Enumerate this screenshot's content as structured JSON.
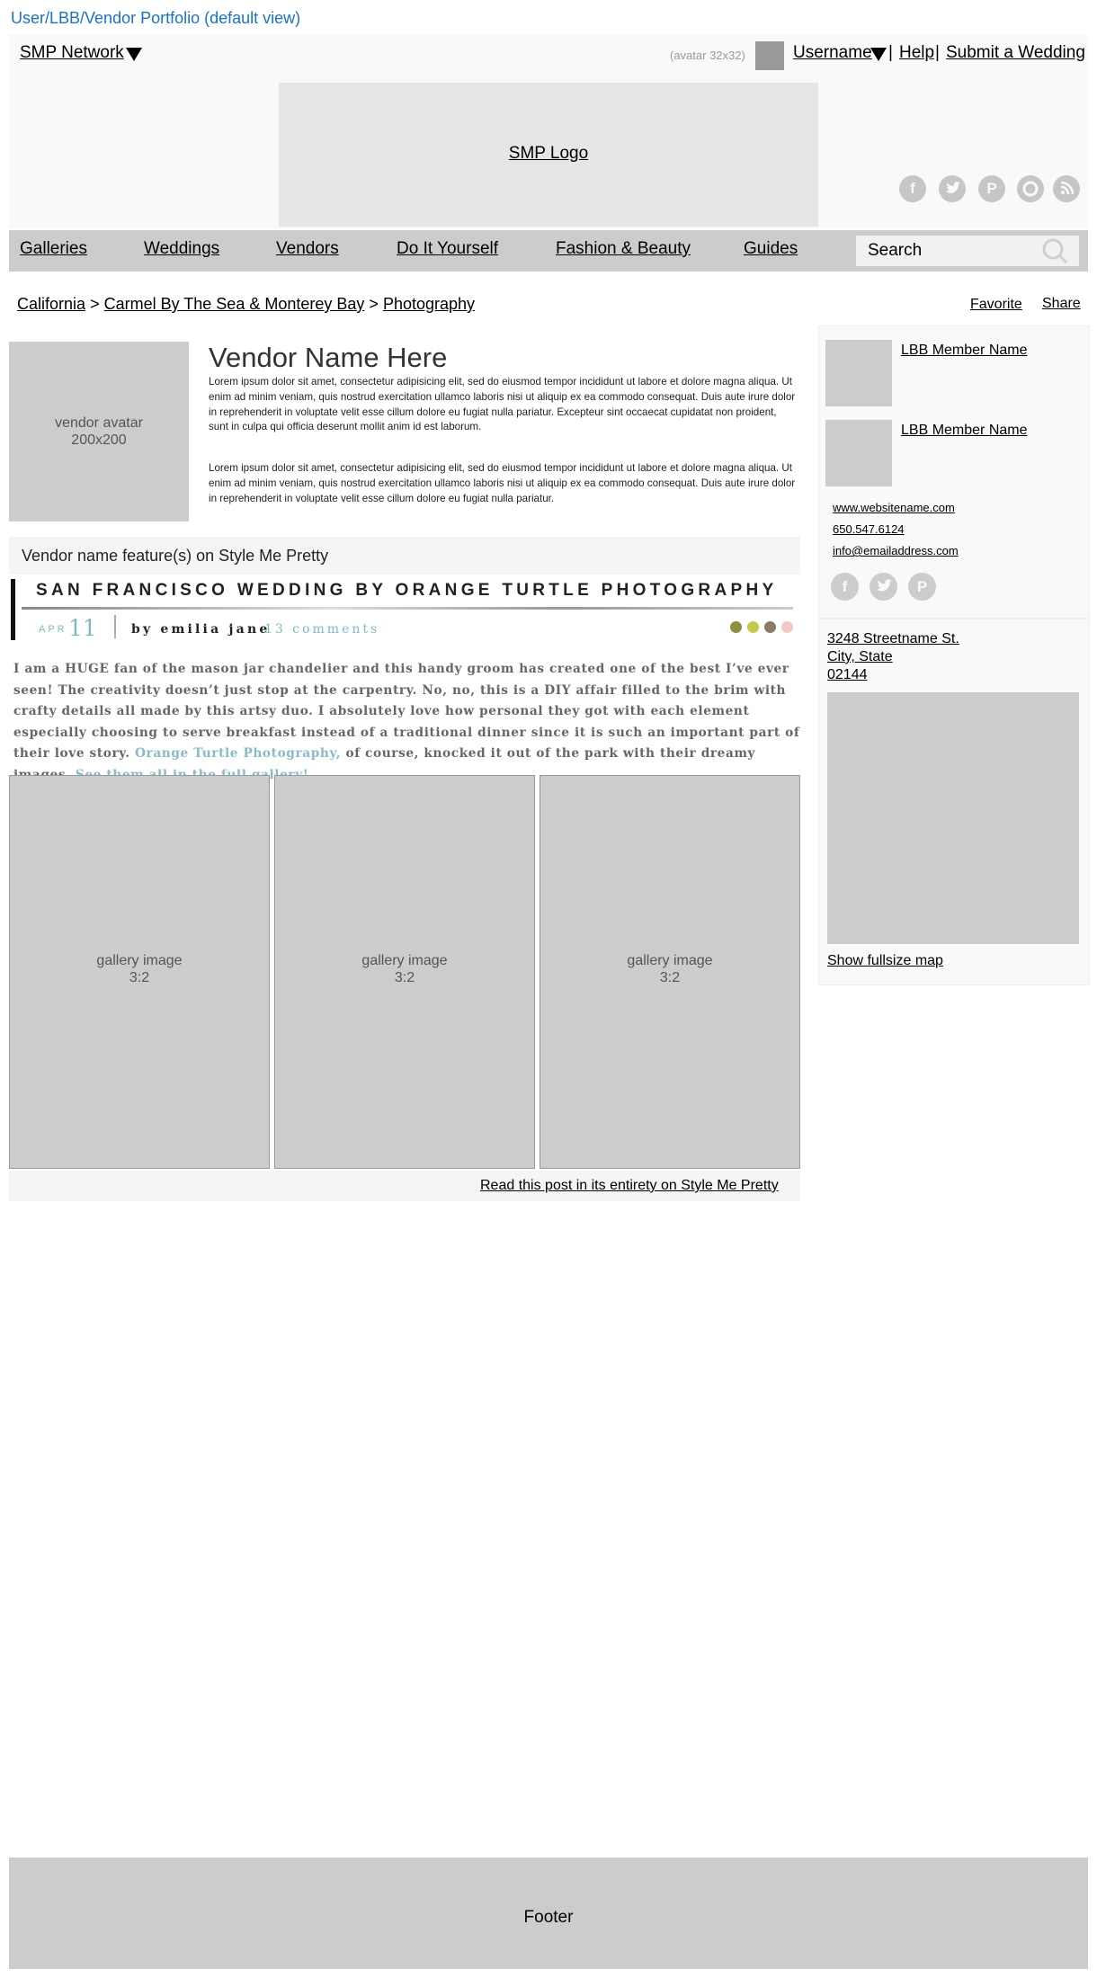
{
  "page_label": "User/LBB/Vendor Portfolio (default view)",
  "header": {
    "network": "SMP Network",
    "avatar_label": "(avatar 32x32)",
    "username": "Username",
    "separator": "|",
    "help": "Help",
    "submit": "Submit a Wedding",
    "logo": "SMP Logo",
    "social_icons": [
      "facebook-icon",
      "twitter-icon",
      "pinterest-icon",
      "instagram-icon",
      "rss-icon"
    ]
  },
  "nav": {
    "items": [
      "Galleries",
      "Weddings",
      "Vendors",
      "Do It Yourself",
      "Fashion & Beauty",
      "Guides"
    ],
    "search_placeholder": "Search"
  },
  "breadcrumb": {
    "items": [
      "California",
      "Carmel By The Sea & Monterey Bay",
      "Photography"
    ],
    "separator": ">"
  },
  "actions": {
    "favorite": "Favorite",
    "share": "Share"
  },
  "vendor": {
    "avatar_label_1": "vendor avatar",
    "avatar_label_2": "200x200",
    "name": "Vendor Name Here",
    "bio_1": "Lorem ipsum dolor sit amet, consectetur adipisicing elit, sed do eiusmod tempor incididunt ut labore et dolore magna aliqua. Ut enim ad minim veniam, quis nostrud exercitation ullamco laboris nisi ut aliquip ex ea commodo consequat. Duis aute irure dolor in reprehenderit in voluptate velit esse cillum dolore eu fugiat nulla pariatur. Excepteur sint occaecat cupidatat non proident, sunt in culpa qui officia deserunt mollit anim id est laborum.",
    "bio_2": "Lorem ipsum dolor sit amet, consectetur adipisicing elit, sed do eiusmod tempor incididunt ut labore et dolore magna aliqua. Ut enim ad minim veniam, quis nostrud exercitation ullamco laboris nisi ut aliquip ex ea commodo consequat. Duis aute irure dolor in reprehenderit in voluptate velit esse cillum dolore eu fugiat nulla pariatur."
  },
  "feature": {
    "section_title": "Vendor name feature(s) on Style Me Pretty",
    "post_title": "SAN FRANCISCO WEDDING BY ORANGE TURTLE PHOTOGRAPHY",
    "month": "APR",
    "day": "11",
    "byline": "by emilia jane",
    "comments": "13 comments",
    "dot_colors": [
      "#8f8e3e",
      "#c5c94a",
      "#8a7a66",
      "#f2c8c4"
    ],
    "body_1": "I am a HUGE fan of the mason jar chandelier and this handy groom has created one of the best I’ve ever seen!  The creativity doesn’t just stop at the carpentry.  No, no, this is a DIY affair filled to the brim with crafty details all made by this artsy duo.  I absolutely love how personal they got with each element especially choosing to serve breakfast instead of a traditional dinner since it is such an important part of their love story.  ",
    "body_link_1": "Orange Turtle Photography,",
    "body_2": " of course, knocked it out of the park with their dreamy images.  ",
    "body_link_2": "See them all in the full gallery!",
    "gallery_label": "gallery image",
    "gallery_ratio": "3:2",
    "read_more": "Read this post in its entirety on Style Me Pretty"
  },
  "sidebar": {
    "members": [
      "LBB Member Name",
      "LBB Member Name"
    ],
    "website": "www.websitename.com",
    "phone": "650.547.6124",
    "email": "info@emailaddress.com",
    "social_icons": [
      "facebook-icon",
      "twitter-icon",
      "pinterest-icon"
    ],
    "address_1": "3248 Streetname St.",
    "address_2": "City, State",
    "address_3": "02144",
    "map_link": "Show fullsize map"
  },
  "footer": "Footer"
}
